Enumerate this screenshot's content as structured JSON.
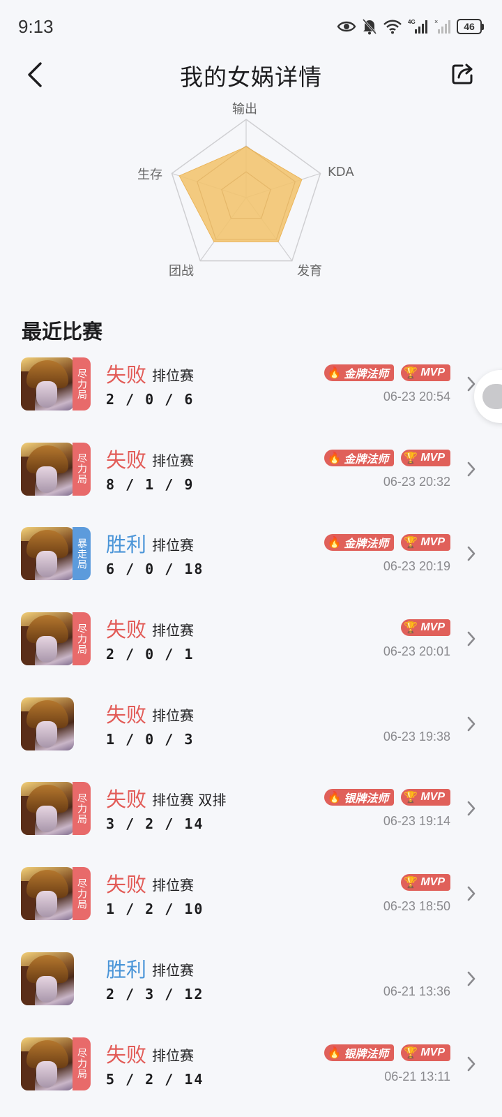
{
  "status_bar": {
    "time": "9:13",
    "battery": "46",
    "icons": [
      "eye-icon",
      "bell-off-icon",
      "wifi-icon",
      "signal-4g-icon",
      "signal-icon",
      "battery-icon"
    ]
  },
  "header": {
    "title": "我的女娲详情",
    "back_icon": "chevron-left-icon",
    "share_icon": "share-icon"
  },
  "radar": {
    "labels": {
      "output": "输出",
      "kda": "KDA",
      "growth": "发育",
      "teamfight": "团战",
      "survival": "生存"
    },
    "values": {
      "output": 0.65,
      "kda": 0.75,
      "growth": 0.7,
      "teamfight": 0.7,
      "survival": 0.9
    },
    "fill_color": "#f2c46d"
  },
  "section": {
    "title": "最近比赛"
  },
  "matches": [
    {
      "result": "失败",
      "result_type": "lose",
      "type": "排位赛",
      "kda": "2 / 0 / 6",
      "time": "06-23 20:54",
      "tag": "尽力局",
      "tag_color": "red",
      "badges": [
        "金牌法师",
        "MVP"
      ]
    },
    {
      "result": "失败",
      "result_type": "lose",
      "type": "排位赛",
      "kda": "8 / 1 / 9",
      "time": "06-23 20:32",
      "tag": "尽力局",
      "tag_color": "red",
      "badges": [
        "金牌法师",
        "MVP"
      ]
    },
    {
      "result": "胜利",
      "result_type": "win",
      "type": "排位赛",
      "kda": "6 / 0 / 18",
      "time": "06-23 20:19",
      "tag": "暴走局",
      "tag_color": "blue",
      "badges": [
        "金牌法师",
        "MVP"
      ]
    },
    {
      "result": "失败",
      "result_type": "lose",
      "type": "排位赛",
      "kda": "2 / 0 / 1",
      "time": "06-23 20:01",
      "tag": "尽力局",
      "tag_color": "red",
      "badges": [
        "MVP"
      ]
    },
    {
      "result": "失败",
      "result_type": "lose",
      "type": "排位赛",
      "kda": "1 / 0 / 3",
      "time": "06-23 19:38",
      "tag": "",
      "tag_color": "",
      "badges": []
    },
    {
      "result": "失败",
      "result_type": "lose",
      "type": "排位赛 双排",
      "kda": "3 / 2 / 14",
      "time": "06-23 19:14",
      "tag": "尽力局",
      "tag_color": "red",
      "badges": [
        "银牌法师",
        "MVP"
      ]
    },
    {
      "result": "失败",
      "result_type": "lose",
      "type": "排位赛",
      "kda": "1 / 2 / 10",
      "time": "06-23 18:50",
      "tag": "尽力局",
      "tag_color": "red",
      "badges": [
        "MVP"
      ]
    },
    {
      "result": "胜利",
      "result_type": "win",
      "type": "排位赛",
      "kda": "2 / 3 / 12",
      "time": "06-21 13:36",
      "tag": "",
      "tag_color": "",
      "badges": []
    },
    {
      "result": "失败",
      "result_type": "lose",
      "type": "排位赛",
      "kda": "5 / 2 / 14",
      "time": "06-21 13:11",
      "tag": "尽力局",
      "tag_color": "red",
      "badges": [
        "银牌法师",
        "MVP"
      ]
    }
  ]
}
